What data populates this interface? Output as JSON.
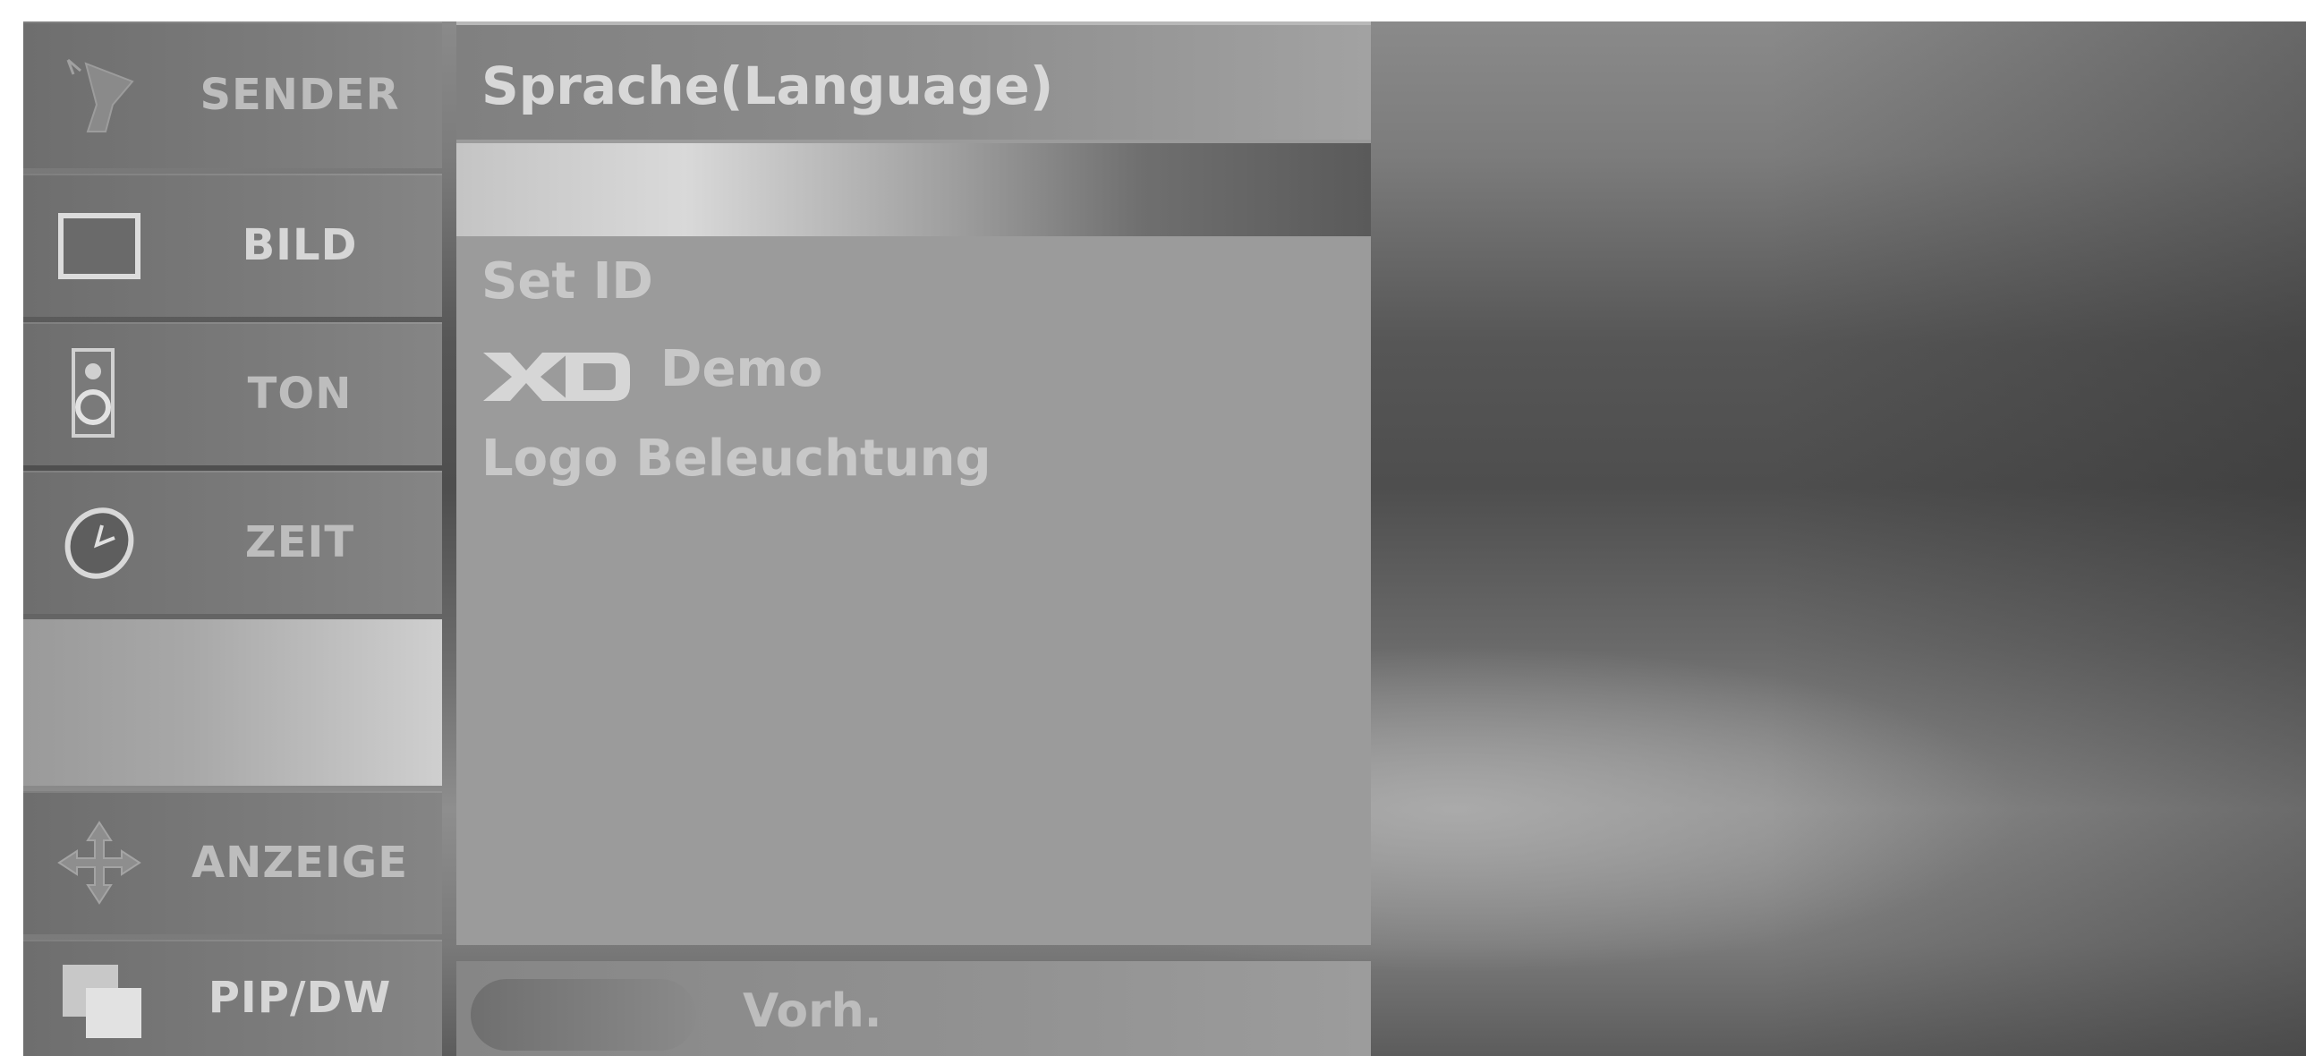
{
  "menu": {
    "categories": [
      {
        "label": "SENDER",
        "icon": "satellite-dish-icon"
      },
      {
        "label": "BILD",
        "icon": "monitor-icon"
      },
      {
        "label": "TON",
        "icon": "speaker-icon"
      },
      {
        "label": "ZEIT",
        "icon": "clock-icon"
      },
      {
        "label": "ANZEIGE",
        "icon": "move-arrows-icon"
      },
      {
        "label": "PIP/DW",
        "icon": "pip-windows-icon"
      }
    ]
  },
  "panel": {
    "title": "Sprache(Language)",
    "items": [
      "Set ID",
      "Demo",
      "Logo Beleuchtung"
    ],
    "demo_logo": "XD"
  },
  "footer": {
    "label": "Vorh."
  }
}
